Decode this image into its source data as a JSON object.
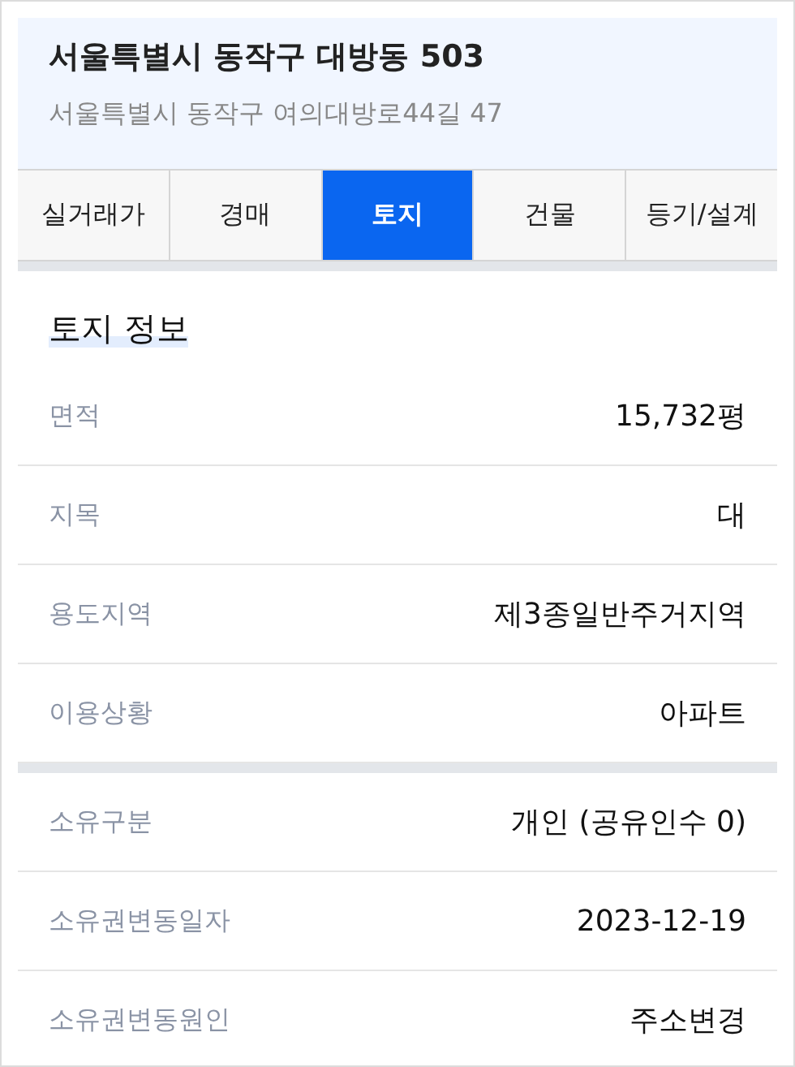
{
  "header": {
    "title": "서울특별시 동작구 대방동 503",
    "subtitle": "서울특별시 동작구 여의대방로44길 47"
  },
  "tabs": [
    {
      "label": "실거래가",
      "selected": false
    },
    {
      "label": "경매",
      "selected": false
    },
    {
      "label": "토지",
      "selected": true
    },
    {
      "label": "건물",
      "selected": false
    },
    {
      "label": "등기/설계",
      "selected": false
    }
  ],
  "section_title": "토지 정보",
  "groups": [
    [
      {
        "label": "면적",
        "value": "15,732평"
      },
      {
        "label": "지목",
        "value": "대"
      },
      {
        "label": "용도지역",
        "value": "제3종일반주거지역"
      },
      {
        "label": "이용상황",
        "value": "아파트"
      }
    ],
    [
      {
        "label": "소유구분",
        "value": "개인 (공유인수 0)"
      },
      {
        "label": "소유권변동일자",
        "value": "2023-12-19"
      },
      {
        "label": "소유권변동원인",
        "value": "주소변경"
      }
    ]
  ]
}
